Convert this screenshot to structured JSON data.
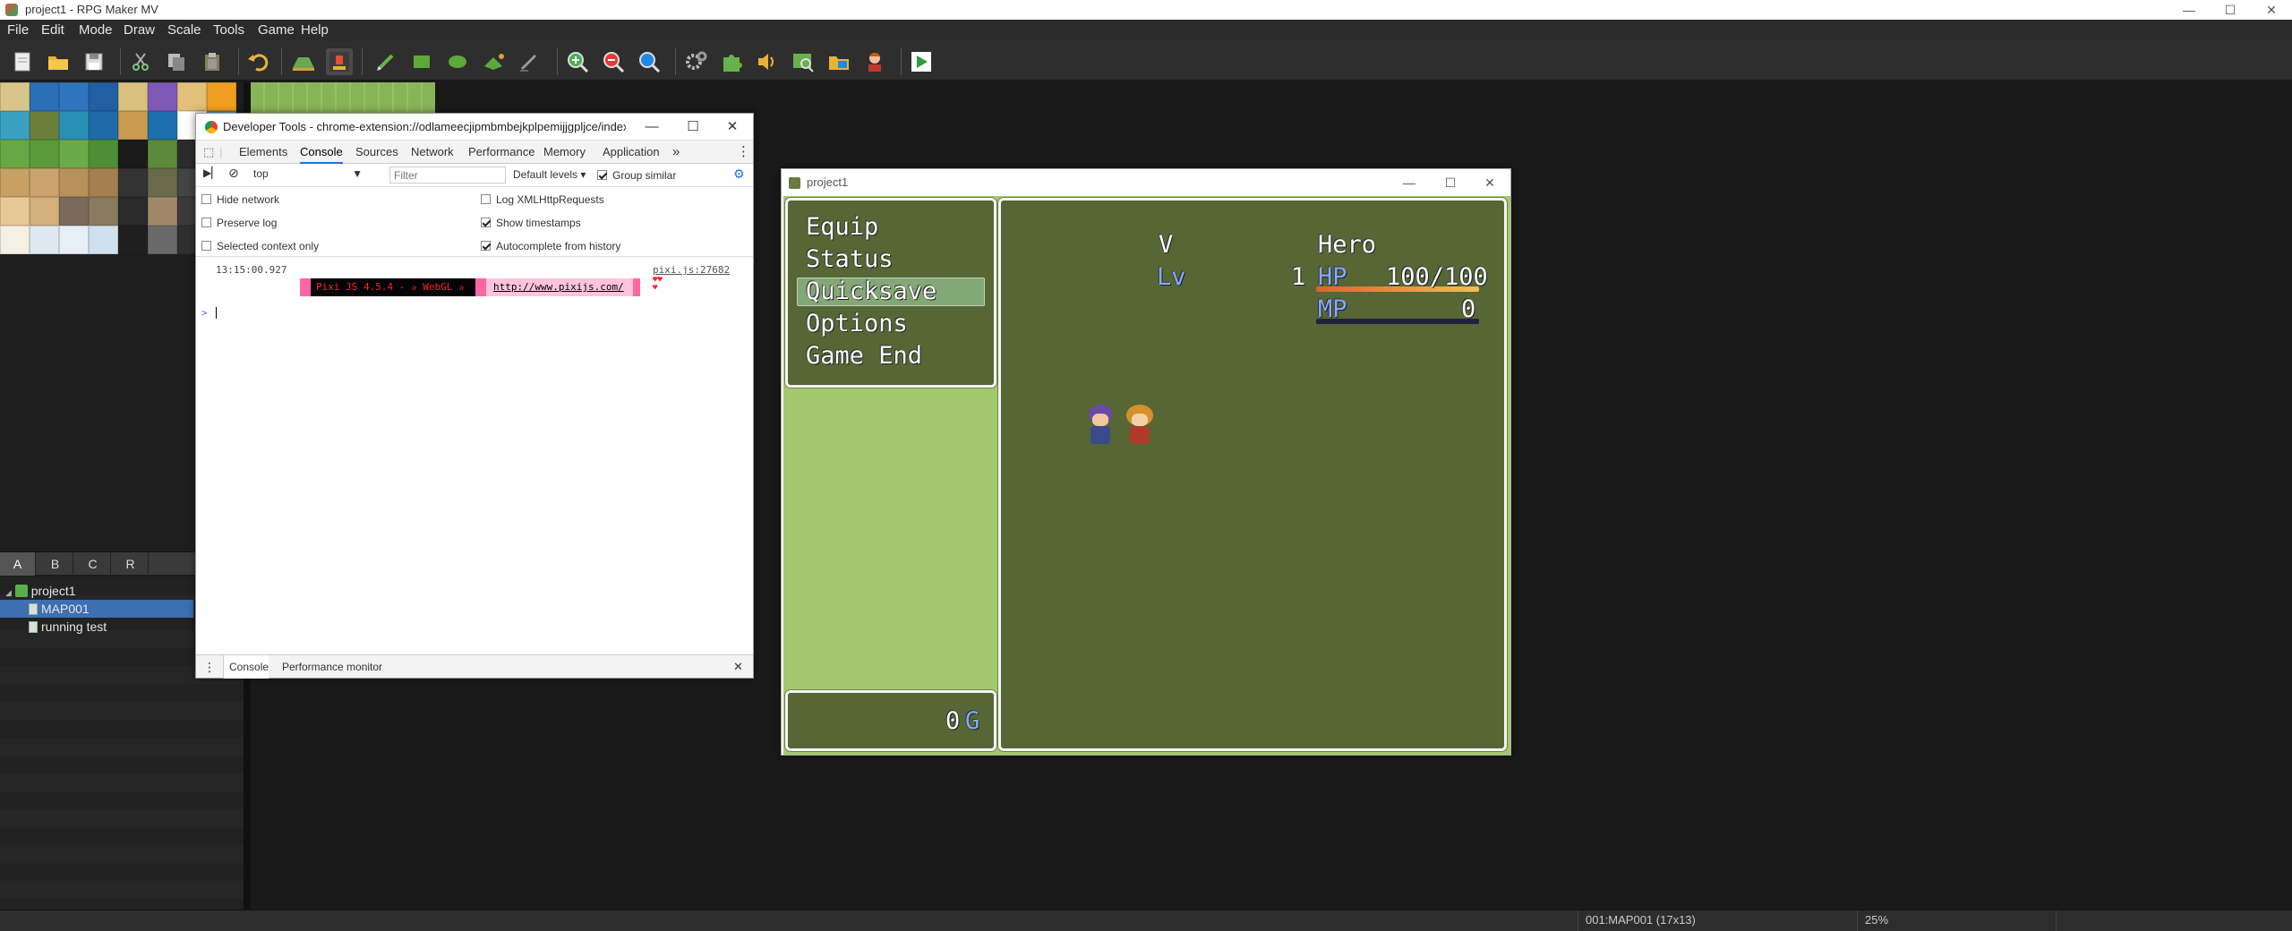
{
  "app": {
    "title": "project1 - RPG Maker MV",
    "window_controls": [
      "—",
      "☐",
      "✕"
    ]
  },
  "menu": [
    "File",
    "Edit",
    "Mode",
    "Draw",
    "Scale",
    "Tools",
    "Game",
    "Help"
  ],
  "toolbar": {
    "buttons": [
      "new-project",
      "open-project",
      "save-project",
      "cut",
      "copy",
      "paste",
      "undo",
      "map-mode",
      "event-mode",
      "pencil",
      "rectangle",
      "ellipse",
      "fill",
      "shadow-pen",
      "zoom-in",
      "zoom-out",
      "actual-size",
      "database",
      "plugin-manager",
      "sound-test",
      "event-searcher",
      "resource-manager",
      "character-generator",
      "playtest"
    ],
    "active": "event-mode"
  },
  "tileset_tabs": [
    "A",
    "B",
    "C",
    "R"
  ],
  "tileset_tab_selected": "A",
  "map_tree": {
    "root": "project1",
    "maps": [
      "MAP001",
      "running test"
    ],
    "selected": "MAP001"
  },
  "status_bar": {
    "map_info": "001:MAP001 (17x13)",
    "zoom": "25%"
  },
  "devtools": {
    "title": "Developer Tools - chrome-extension://odlameecjipmbmbejkplpemijjgpljce/index.ht...",
    "tabs": [
      "Elements",
      "Console",
      "Sources",
      "Network",
      "Performance",
      "Memory",
      "Application"
    ],
    "selected_tab": "Console",
    "more_tabs": "»",
    "context": "top",
    "filter_placeholder": "Filter",
    "levels": "Default levels",
    "group_similar": "Group similar",
    "settings_left": [
      {
        "label": "Hide network",
        "checked": false
      },
      {
        "label": "Preserve log",
        "checked": false
      },
      {
        "label": "Selected context only",
        "checked": false
      }
    ],
    "settings_right": [
      {
        "label": "Log XMLHttpRequests",
        "checked": false
      },
      {
        "label": "Show timestamps",
        "checked": true
      },
      {
        "label": "Autocomplete from history",
        "checked": true
      }
    ],
    "log": {
      "timestamp": "13:15:00.927",
      "source": "pixi.js:27682",
      "banner_text": "Pixi JS 4.5.4 - ✰ WebGL ✰",
      "banner_link": "http://www.pixijs.com/",
      "hearts": "♥♥♥"
    },
    "prompt": ">",
    "drawer_tabs": [
      "Console",
      "Performance monitor"
    ]
  },
  "game": {
    "window_title": "project1",
    "menu_commands": [
      "Equip",
      "Status",
      "Quicksave",
      "Options",
      "Game End"
    ],
    "selected_command": "Quicksave",
    "gold": {
      "value": "0",
      "unit": "G"
    },
    "actor": {
      "name": "Hero",
      "class": "V",
      "level_label": "Lv",
      "level": "1",
      "hp_label": "HP",
      "hp": "100/100",
      "hp_ratio": 1.0,
      "mp_label": "MP",
      "mp": "0",
      "mp_ratio": 0.0
    },
    "colors": {
      "system_text": "#84aaff",
      "hp_gauge": "#e08040",
      "mp_gauge": "#4060c0"
    }
  }
}
